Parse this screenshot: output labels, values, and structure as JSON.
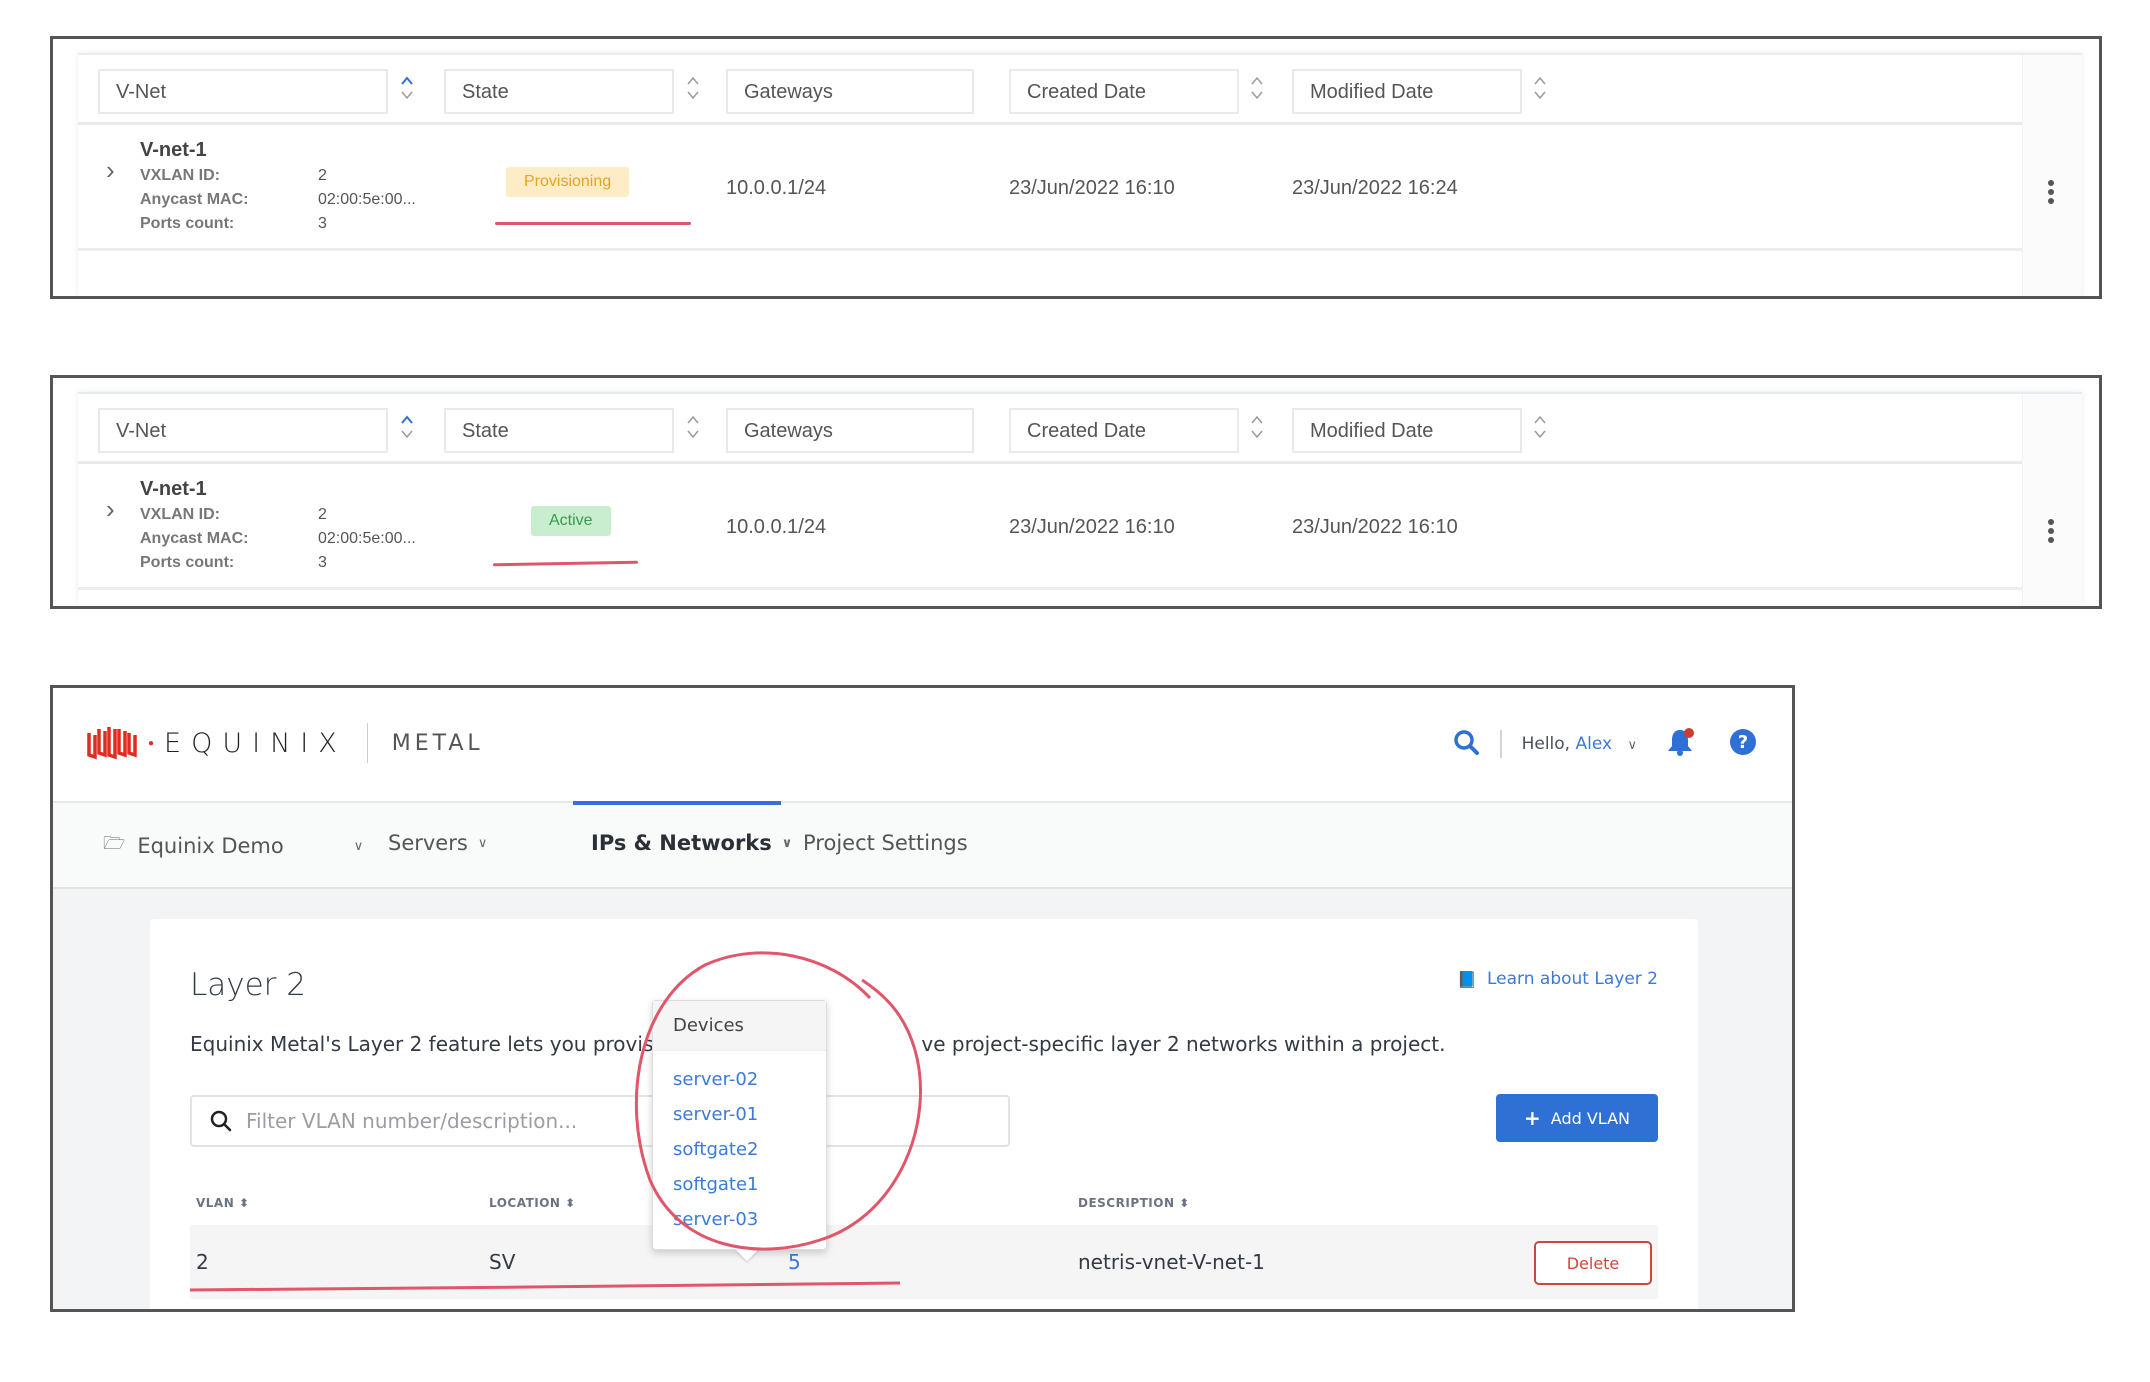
{
  "vnet_panels": [
    {
      "headers": {
        "vnet": "V-Net",
        "state": "State",
        "gateways": "Gateways",
        "created": "Created Date",
        "modified": "Modified Date"
      },
      "row": {
        "name": "V-net-1",
        "vxlan_label": "VXLAN ID:",
        "vxlan_value": "2",
        "mac_label": "Anycast MAC:",
        "mac_value": "02:00:5e:00...",
        "ports_label": "Ports count:",
        "ports_value": "3",
        "state": "Provisioning",
        "gateway": "10.0.0.1/24",
        "created": "23/Jun/2022 16:10",
        "modified": "23/Jun/2022 16:24"
      }
    },
    {
      "headers": {
        "vnet": "V-Net",
        "state": "State",
        "gateways": "Gateways",
        "created": "Created Date",
        "modified": "Modified Date"
      },
      "row": {
        "name": "V-net-1",
        "vxlan_label": "VXLAN ID:",
        "vxlan_value": "2",
        "mac_label": "Anycast MAC:",
        "mac_value": "02:00:5e:00...",
        "ports_label": "Ports count:",
        "ports_value": "3",
        "state": "Active",
        "gateway": "10.0.0.1/24",
        "created": "23/Jun/2022 16:10",
        "modified": "23/Jun/2022 16:10"
      }
    }
  ],
  "colors": {
    "provisioning_bg": "#fdecc6",
    "provisioning_text": "#e6a323",
    "active_bg": "#c9edcf",
    "active_text": "#3a9a4b",
    "brand_red": "#e02b20",
    "accent_blue": "#2f70d4",
    "annotation_red": "#e0566a"
  },
  "equinix": {
    "logo_word": "EQUINIX",
    "logo_product": "METAL",
    "greeting": "Hello,",
    "user_name": "Alex",
    "nav": {
      "project": "Equinix Demo",
      "servers": "Servers",
      "ips_networks": "IPs & Networks",
      "project_settings": "Project Settings"
    },
    "layer2": {
      "title": "Layer 2",
      "learn_link": "Learn about Layer 2",
      "description": "Equinix Metal's Layer 2 feature lets you provision betw",
      "description_tail": "ve project-specific layer 2 networks within a project.",
      "filter_placeholder": "Filter VLAN number/description...",
      "add_button": "Add VLAN",
      "columns": {
        "vlan": "VLAN",
        "location": "LOCATION",
        "description": "DESCRIPTION"
      },
      "rows": [
        {
          "vlan": "2",
          "location": "SV",
          "devices": "5",
          "description": "netris-vnet-V-net-1",
          "delete": "Delete"
        }
      ],
      "devices_popover": {
        "title": "Devices",
        "items": [
          "server-02",
          "server-01",
          "softgate2",
          "softgate1",
          "server-03"
        ]
      }
    }
  }
}
